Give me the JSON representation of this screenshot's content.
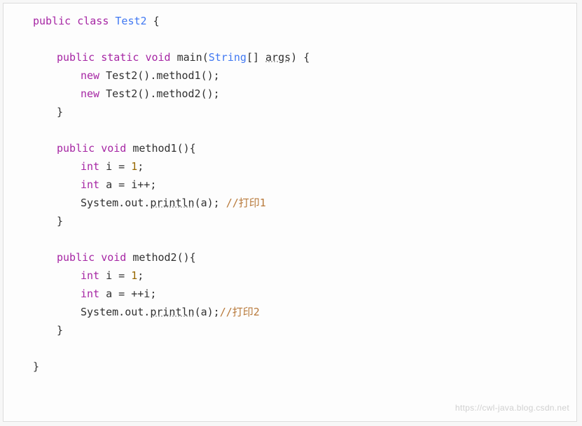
{
  "code": {
    "kw_public": "public",
    "kw_class": "class",
    "cls_name": "Test2",
    "brace_open": "{",
    "brace_close": "}",
    "kw_static": "static",
    "kw_void": "void",
    "kw_new": "new",
    "kw_int": "int",
    "main_name": "main",
    "cls_string": "String",
    "args_name": "args",
    "args_brackets": "[]",
    "paren_open": "(",
    "paren_close": ")",
    "call_method1": "().method1();",
    "call_method2": "().method2();",
    "method1_name": "method1",
    "method2_name": "method2",
    "empty_parens_brace": "(){",
    "var_i": "i",
    "var_a": "a",
    "eq": " = ",
    "one": "1",
    "semi": ";",
    "ipp": "i++;",
    "ppi": "++i;",
    "sysout_prefix": "System.out.",
    "println": "println",
    "println_arg_sp": "(a); ",
    "println_arg": "(a);",
    "comment1": "//打印1",
    "comment2": "//打印2"
  },
  "watermark": "https://cwl-java.blog.csdn.net"
}
